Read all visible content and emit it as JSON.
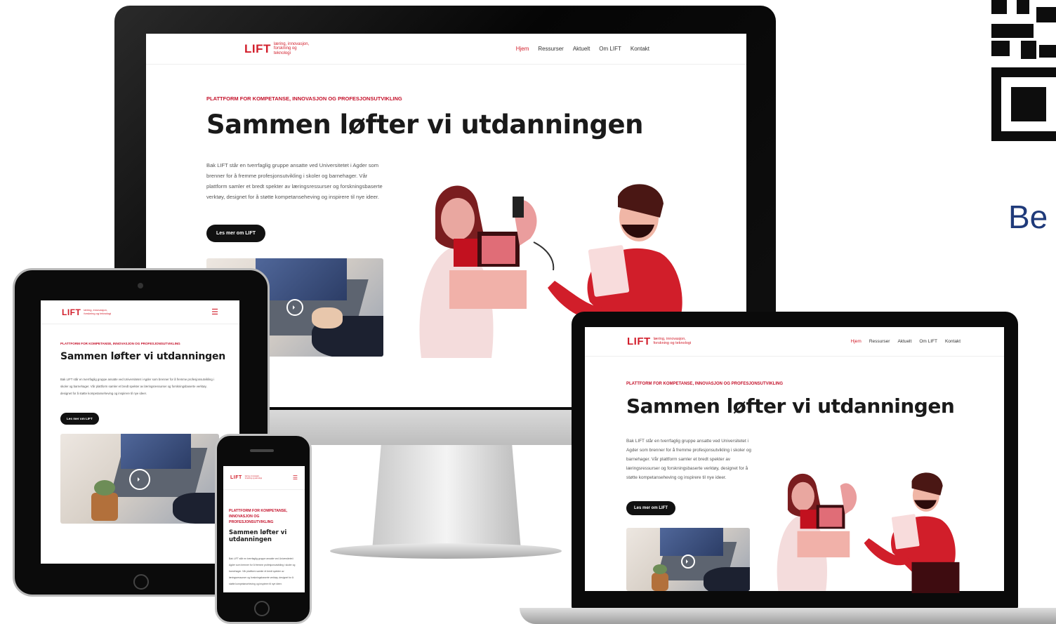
{
  "site": {
    "logo": "LIFT",
    "tagline": "læring, innovasjon, forskning og teknologi",
    "nav": [
      "Hjem",
      "Ressurser",
      "Aktuelt",
      "Om LIFT",
      "Kontakt"
    ],
    "eyebrow": "PLATTFORM FOR KOMPETANSE, INNOVASJON OG PROFESJONSUTVIKLING",
    "title": "Sammen løfter vi utdanningen",
    "intro": "Bak LIFT står en tverrfaglig gruppe ansatte ved Universitetet i Agder som brenner for å fremme profesjonsutvikling i skoler og barnehager. Vår plattform samler et bredt spekter av læringsressurser og forskningsbaserte verktøy, designet for å støtte kompetanseheving og inspirere til nye ideer.",
    "cta": "Les mer om LIFT",
    "play_icon": "play-icon",
    "menu_icon": "hamburger-icon"
  },
  "right_text": "Be",
  "colors": {
    "accent": "#d21e2b",
    "dark": "#111111"
  }
}
